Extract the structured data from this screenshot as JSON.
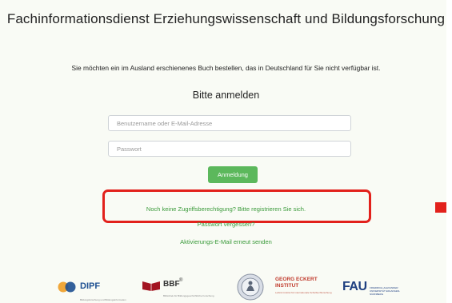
{
  "header": {
    "title": "Fachinformationsdienst Erziehungswissenschaft und Bildungsforschung"
  },
  "intro_text": "Sie möchten ein im Ausland erschienenes Buch bestellen, das in Deutschland für Sie nicht verfügbar ist.",
  "login": {
    "heading": "Bitte anmelden",
    "username_placeholder": "Benutzername oder E-Mail-Adresse",
    "password_placeholder": "Passwort",
    "submit_label": "Anmeldung"
  },
  "links": {
    "register": "Noch keine Zugriffsberechtigung? Bitte registrieren Sie sich.",
    "forgot_password": "Passwort vergessen?",
    "resend_activation": "Aktivierungs-E-Mail erneut senden"
  },
  "annotation": {
    "highlight_color": "#e2211c"
  },
  "colors": {
    "accent_green": "#5cb85c",
    "link_green": "#3a9a3a",
    "background": "#f9fbf5"
  },
  "footer_logos": [
    {
      "name": "DIPF",
      "subtext": "Bildungsforschung und Bildungsinformation",
      "icon": "dipf-circles-icon"
    },
    {
      "name": "BBF",
      "suffix": "®",
      "subtext": "Bibliothek für Bildungsgeschichtliche Forschung",
      "icon": "bbf-book-icon"
    },
    {
      "name": "",
      "icon": "university-seal-icon"
    },
    {
      "name": "GEORG ECKERT",
      "line2": "INSTITUT",
      "subtext": "Leibniz-Institut für internationale Schulbuchforschung",
      "icon": "gei-wordmark"
    },
    {
      "name": "FAU",
      "subtext": "FRIEDRICH-ALEXANDER UNIVERSITÄT ERLANGEN-NÜRNBERG",
      "icon": "fau-wordmark"
    }
  ]
}
